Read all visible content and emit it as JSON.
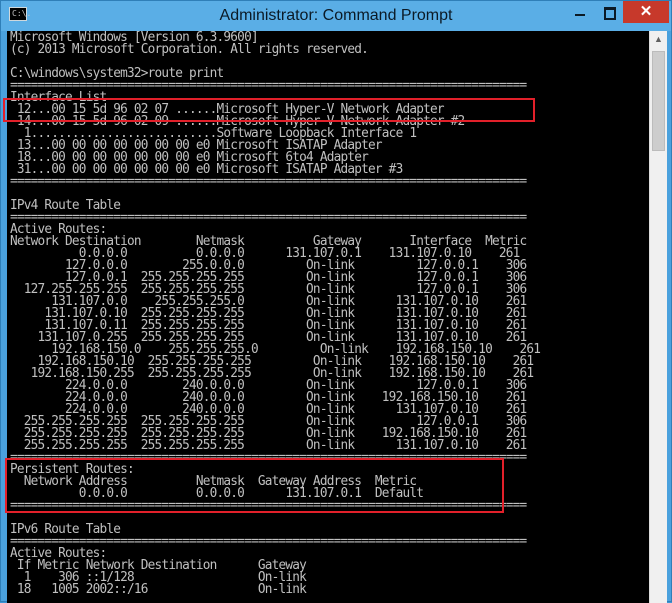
{
  "window": {
    "title": "Administrator: Command Prompt",
    "icon_label": "C:\\.",
    "buttons": {
      "minimize": "minimize-icon",
      "maximize": "maximize-icon",
      "close": "✕"
    }
  },
  "console_lines": [
    "Microsoft Windows [Version 6.3.9600]",
    "(c) 2013 Microsoft Corporation. All rights reserved.",
    "",
    "C:\\windows\\system32>route print",
    "===========================================================================",
    "Interface List",
    " 12...00 15 5d 96 02 07 ......Microsoft Hyper-V Network Adapter",
    " 14...00 15 5d 96 02 09 ......Microsoft Hyper-V Network Adapter #2",
    "  1...........................Software Loopback Interface 1",
    " 13...00 00 00 00 00 00 00 e0 Microsoft ISATAP Adapter",
    " 18...00 00 00 00 00 00 00 e0 Microsoft 6to4 Adapter",
    " 31...00 00 00 00 00 00 00 e0 Microsoft ISATAP Adapter #3",
    "===========================================================================",
    "",
    "IPv4 Route Table",
    "===========================================================================",
    "Active Routes:",
    "Network Destination        Netmask          Gateway       Interface  Metric",
    "          0.0.0.0          0.0.0.0      131.107.0.1    131.107.0.10    261",
    "        127.0.0.0        255.0.0.0         On-link         127.0.0.1    306",
    "        127.0.0.1  255.255.255.255         On-link         127.0.0.1    306",
    "  127.255.255.255  255.255.255.255         On-link         127.0.0.1    306",
    "      131.107.0.0    255.255.255.0         On-link      131.107.0.10    261",
    "     131.107.0.10  255.255.255.255         On-link      131.107.0.10    261",
    "     131.107.0.11  255.255.255.255         On-link      131.107.0.10    261",
    "    131.107.0.255  255.255.255.255         On-link      131.107.0.10    261",
    "      192.168.150.0    255.255.255.0         On-link    192.168.150.10    261",
    "    192.168.150.10  255.255.255.255         On-link    192.168.150.10    261",
    "   192.168.150.255  255.255.255.255         On-link    192.168.150.10    261",
    "        224.0.0.0        240.0.0.0         On-link         127.0.0.1    306",
    "        224.0.0.0        240.0.0.0         On-link    192.168.150.10    261",
    "        224.0.0.0        240.0.0.0         On-link      131.107.0.10    261",
    "  255.255.255.255  255.255.255.255         On-link         127.0.0.1    306",
    "  255.255.255.255  255.255.255.255         On-link    192.168.150.10    261",
    "  255.255.255.255  255.255.255.255         On-link      131.107.0.10    261",
    "===========================================================================",
    "Persistent Routes:",
    "  Network Address          Netmask  Gateway Address  Metric",
    "          0.0.0.0          0.0.0.0      131.107.0.1  Default",
    "===========================================================================",
    "",
    "IPv6 Route Table",
    "===========================================================================",
    "Active Routes:",
    " If Metric Network Destination      Gateway",
    "  1    306 ::1/128                  On-link",
    " 18   1005 2002::/16                On-link"
  ]
}
